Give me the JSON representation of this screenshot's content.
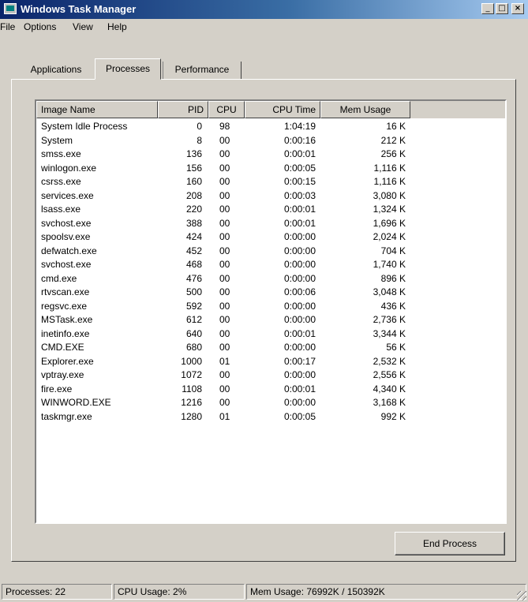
{
  "window": {
    "title": "Windows Task Manager",
    "controls": {
      "minimize": "_",
      "maximize": "□",
      "close": "×"
    }
  },
  "menu": [
    {
      "label": "File"
    },
    {
      "label": "Options"
    },
    {
      "label": "View"
    },
    {
      "label": "Help"
    }
  ],
  "tabs": [
    {
      "label": "Applications",
      "active": false
    },
    {
      "label": "Processes",
      "active": true
    },
    {
      "label": "Performance",
      "active": false
    }
  ],
  "columns": [
    "Image Name",
    "PID",
    "CPU",
    "CPU Time",
    "Mem Usage"
  ],
  "processes": [
    {
      "name": "System Idle Process",
      "pid": "0",
      "cpu": "98",
      "time": "1:04:19",
      "mem": "16 K"
    },
    {
      "name": "System",
      "pid": "8",
      "cpu": "00",
      "time": "0:00:16",
      "mem": "212 K"
    },
    {
      "name": "smss.exe",
      "pid": "136",
      "cpu": "00",
      "time": "0:00:01",
      "mem": "256 K"
    },
    {
      "name": "winlogon.exe",
      "pid": "156",
      "cpu": "00",
      "time": "0:00:05",
      "mem": "1,116 K"
    },
    {
      "name": "csrss.exe",
      "pid": "160",
      "cpu": "00",
      "time": "0:00:15",
      "mem": "1,116 K"
    },
    {
      "name": "services.exe",
      "pid": "208",
      "cpu": "00",
      "time": "0:00:03",
      "mem": "3,080 K"
    },
    {
      "name": "lsass.exe",
      "pid": "220",
      "cpu": "00",
      "time": "0:00:01",
      "mem": "1,324 K"
    },
    {
      "name": "svchost.exe",
      "pid": "388",
      "cpu": "00",
      "time": "0:00:01",
      "mem": "1,696 K"
    },
    {
      "name": "spoolsv.exe",
      "pid": "424",
      "cpu": "00",
      "time": "0:00:00",
      "mem": "2,024 K"
    },
    {
      "name": "defwatch.exe",
      "pid": "452",
      "cpu": "00",
      "time": "0:00:00",
      "mem": "704 K"
    },
    {
      "name": "svchost.exe",
      "pid": "468",
      "cpu": "00",
      "time": "0:00:00",
      "mem": "1,740 K"
    },
    {
      "name": "cmd.exe",
      "pid": "476",
      "cpu": "00",
      "time": "0:00:00",
      "mem": "896 K"
    },
    {
      "name": "rtvscan.exe",
      "pid": "500",
      "cpu": "00",
      "time": "0:00:06",
      "mem": "3,048 K"
    },
    {
      "name": "regsvc.exe",
      "pid": "592",
      "cpu": "00",
      "time": "0:00:00",
      "mem": "436 K"
    },
    {
      "name": "MSTask.exe",
      "pid": "612",
      "cpu": "00",
      "time": "0:00:00",
      "mem": "2,736 K"
    },
    {
      "name": "inetinfo.exe",
      "pid": "640",
      "cpu": "00",
      "time": "0:00:01",
      "mem": "3,344 K"
    },
    {
      "name": "CMD.EXE",
      "pid": "680",
      "cpu": "00",
      "time": "0:00:00",
      "mem": "56 K"
    },
    {
      "name": "Explorer.exe",
      "pid": "1000",
      "cpu": "01",
      "time": "0:00:17",
      "mem": "2,532 K"
    },
    {
      "name": "vptray.exe",
      "pid": "1072",
      "cpu": "00",
      "time": "0:00:00",
      "mem": "2,556 K"
    },
    {
      "name": "fire.exe",
      "pid": "1108",
      "cpu": "00",
      "time": "0:00:01",
      "mem": "4,340 K"
    },
    {
      "name": "WINWORD.EXE",
      "pid": "1216",
      "cpu": "00",
      "time": "0:00:00",
      "mem": "3,168 K"
    },
    {
      "name": "taskmgr.exe",
      "pid": "1280",
      "cpu": "01",
      "time": "0:00:05",
      "mem": "992 K"
    }
  ],
  "buttons": {
    "end_process": "End Process"
  },
  "status": {
    "processes": "Processes: 22",
    "cpu": "CPU Usage: 2%",
    "mem": "Mem Usage: 76992K / 150392K"
  }
}
